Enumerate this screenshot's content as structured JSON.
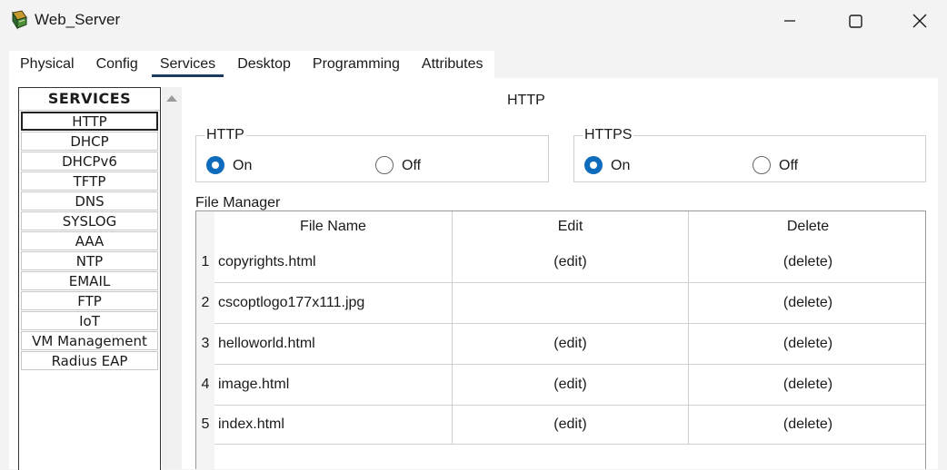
{
  "window": {
    "title": "Web_Server",
    "icons": {
      "app": "router-icon",
      "minimize": "minimize-icon",
      "maximize": "maximize-icon",
      "close": "close-icon"
    }
  },
  "tabs": [
    {
      "label": "Physical",
      "active": false
    },
    {
      "label": "Config",
      "active": false
    },
    {
      "label": "Services",
      "active": true
    },
    {
      "label": "Desktop",
      "active": false
    },
    {
      "label": "Programming",
      "active": false
    },
    {
      "label": "Attributes",
      "active": false
    }
  ],
  "sidebar": {
    "header": "SERVICES",
    "items": [
      "HTTP",
      "DHCP",
      "DHCPv6",
      "TFTP",
      "DNS",
      "SYSLOG",
      "AAA",
      "NTP",
      "EMAIL",
      "FTP",
      "IoT",
      "VM Management",
      "Radius EAP"
    ],
    "selected": "HTTP"
  },
  "panel": {
    "title": "HTTP",
    "http": {
      "legend": "HTTP",
      "on_label": "On",
      "off_label": "Off",
      "value": "On"
    },
    "https": {
      "legend": "HTTPS",
      "on_label": "On",
      "off_label": "Off",
      "value": "On"
    }
  },
  "file_manager": {
    "label": "File Manager",
    "columns": [
      "File Name",
      "Edit",
      "Delete"
    ],
    "rows": [
      {
        "num": "1",
        "name": "copyrights.html",
        "edit": "(edit)",
        "delete": "(delete)"
      },
      {
        "num": "2",
        "name": "cscoptlogo177x111.jpg",
        "edit": "",
        "delete": "(delete)"
      },
      {
        "num": "3",
        "name": "helloworld.html",
        "edit": "(edit)",
        "delete": "(delete)"
      },
      {
        "num": "4",
        "name": "image.html",
        "edit": "(edit)",
        "delete": "(delete)"
      },
      {
        "num": "5",
        "name": "index.html",
        "edit": "(edit)",
        "delete": "(delete)"
      }
    ]
  },
  "colors": {
    "accent": "#0f6cbd",
    "tab_underline": "#1f3a5f",
    "background": "#f3f3f3"
  }
}
